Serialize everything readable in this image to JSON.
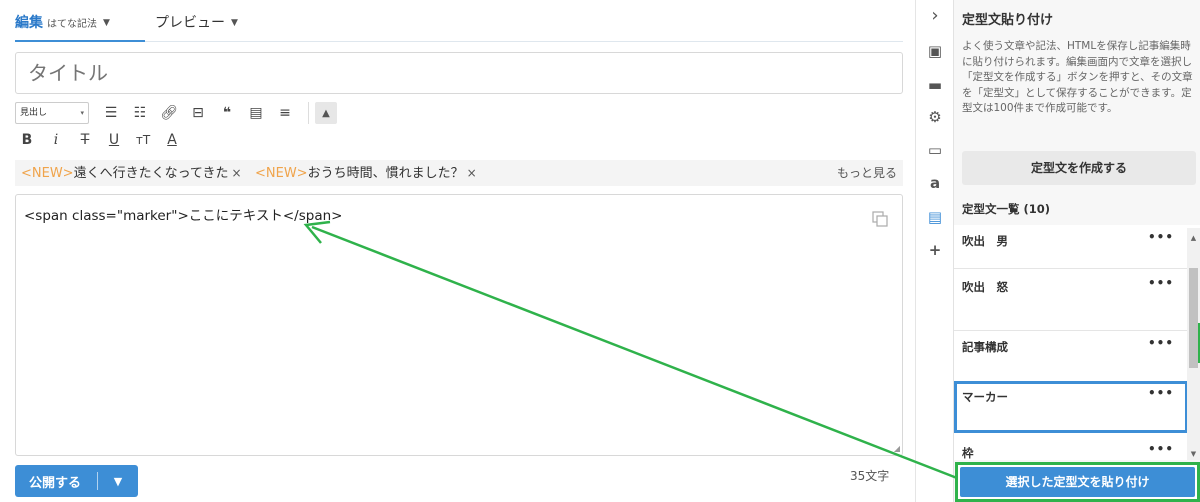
{
  "editor": {
    "tabs": [
      {
        "label": "編集",
        "sub": "はてな記法"
      },
      {
        "label": "プレビュー"
      }
    ],
    "title_placeholder": "タイトル",
    "heading_select": "見出し",
    "news": [
      {
        "tag": "<NEW>",
        "text": "遠くへ行きたくなってきた"
      },
      {
        "tag": "<NEW>",
        "text": "おうち時間、慣れました？"
      }
    ],
    "news_more": "もっと見る",
    "body": "<span class=\"marker\">ここにテキスト</span>",
    "publish_label": "公開する",
    "char_count": "35文字"
  },
  "rail": {
    "icons": [
      "chevron-right-icon",
      "photo-icon",
      "folder-icon",
      "gear-icon",
      "document-icon",
      "amazon-icon",
      "clipboard-icon",
      "plus-icon"
    ],
    "active": "clipboard-icon"
  },
  "panel": {
    "title": "定型文貼り付け",
    "description": "よく使う文章や記法、HTMLを保存し記事編集時に貼り付けられます。編集画面内で文章を選択し「定型文を作成する」ボタンを押すと、その文章を「定型文」として保存することができます。定型文は100件まで作成可能です。",
    "create_label": "定型文を作成する",
    "list_heading": "定型文一覧 (10)",
    "items": [
      {
        "name": "吹出　男",
        "more": "•••"
      },
      {
        "name": "吹出　怒",
        "more": "•••"
      },
      {
        "name": "記事構成",
        "more": "•••"
      },
      {
        "name": "マーカー",
        "more": "•••"
      },
      {
        "name": "枠",
        "more": "•••"
      }
    ],
    "selected_item": "マーカー",
    "paste_label": "選択した定型文を貼り付け"
  },
  "colors": {
    "accent": "#3d8ed6",
    "annotation": "#2fb24b",
    "new_tag": "#f0a44b"
  }
}
